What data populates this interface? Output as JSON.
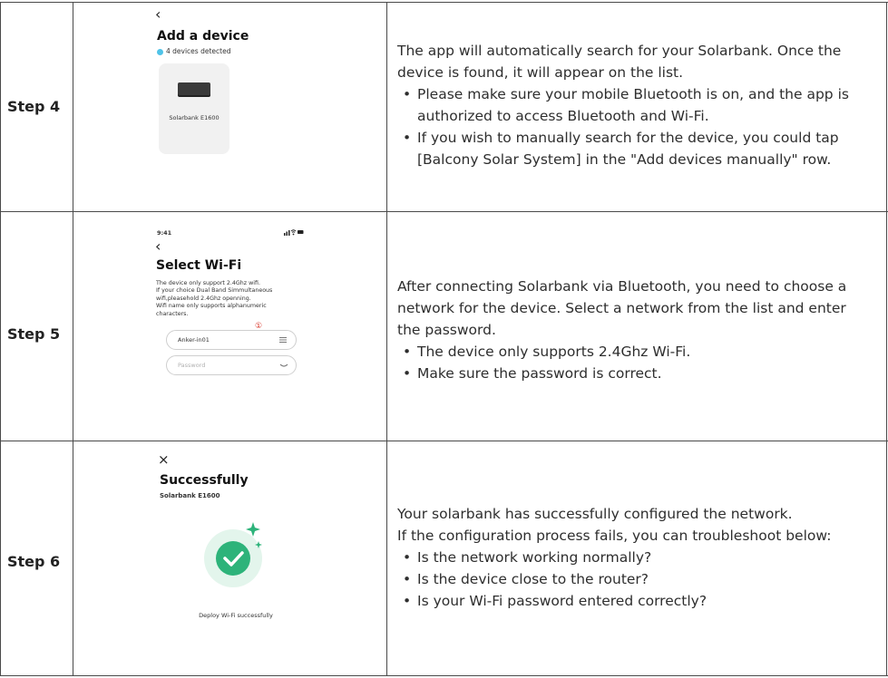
{
  "rows": [
    {
      "step": "Step 4",
      "description": "The app will automatically search for your Solarbank. Once the device is found, it will appear on the list.",
      "bullets": [
        "Please make sure your mobile Bluetooth is on, and the app is authorized to access Bluetooth and Wi-Fi.",
        "If you wish to manually search for the device, you could tap [Balcony Solar System] in the \"Add devices manually\" row."
      ],
      "screen": {
        "back_icon": "‹",
        "title": "Add a device",
        "detected_text": "4 devices detected",
        "device_name": "Solarbank E1600"
      }
    },
    {
      "step": "Step 5",
      "description": "After connecting Solarbank via Bluetooth, you need to choose a network for the device. Select a network from the list and enter the password.",
      "bullets": [
        "The device only supports 2.4Ghz Wi-Fi.",
        "Make sure the password is correct."
      ],
      "screen": {
        "time": "9:41",
        "back_icon": "‹",
        "title": "Select Wi-Fi",
        "info_lines": [
          "The device only support 2.4Ghz wifi.",
          "If your choice Dual Band Simmultaneous",
          "wifi,pleasehold 2.4Ghz openning.",
          "Wifi name only supports alphanumeric",
          "characters."
        ],
        "marker": "①",
        "wifi_value": "Anker-in01",
        "password_placeholder": "Password"
      }
    },
    {
      "step": "Step 6",
      "description_lines": [
        "Your solarbank has successfully configured the network.",
        "If the configuration process fails, you can troubleshoot below:"
      ],
      "bullets": [
        "Is the network working normally?",
        "Is the device close to the router?",
        "Is your Wi-Fi password entered correctly?"
      ],
      "screen": {
        "close_icon": "×",
        "title": "Successfully",
        "subtitle": "Solarbank E1600",
        "status_text": "Deploy Wi-Fi successfully"
      }
    }
  ],
  "colors": {
    "accent_green": "#2db37a",
    "detect_blue": "#4fc3e8",
    "marker_red": "#d9362b",
    "grid_line": "#4a4a4a"
  },
  "icons": [
    "back-chevron-icon",
    "close-icon",
    "signal-icon",
    "wifi-icon",
    "battery-icon",
    "list-icon",
    "chevron-down-icon",
    "check-icon",
    "sparkle-icon"
  ]
}
